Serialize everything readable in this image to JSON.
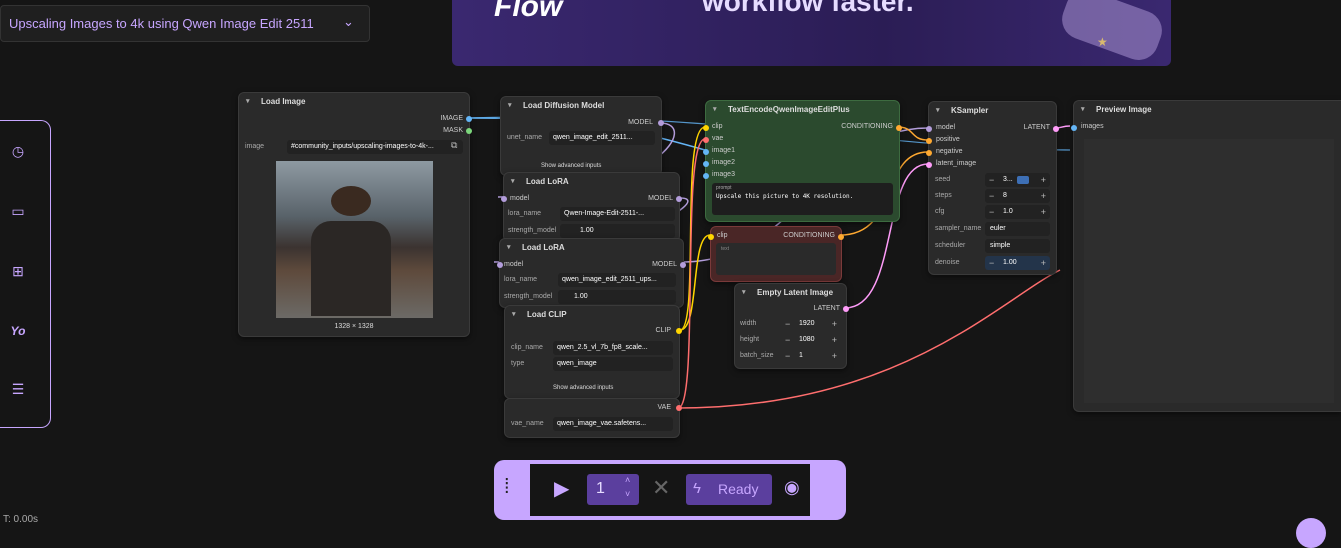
{
  "workflow": {
    "title": "Upscaling Images to 4k using Qwen Image Edit 2511"
  },
  "banner": {
    "logo_text": "Flow",
    "tagline": "workflow faster."
  },
  "sidebar": {
    "items": [
      {
        "icon": "clock-icon",
        "glyph": "◷"
      },
      {
        "icon": "folder-icon",
        "glyph": "▭"
      },
      {
        "icon": "workflow-icon",
        "glyph": "⊞"
      },
      {
        "icon": "logo-icon",
        "glyph": "Yo"
      },
      {
        "icon": "sliders-icon",
        "glyph": "☰"
      }
    ]
  },
  "nodes": {
    "load_image": {
      "title": "Load Image",
      "out1": "IMAGE",
      "out2": "MASK",
      "label": "image",
      "value": "#community_inputs/upscaling-images-to-4k-...",
      "dims": "1328 × 1328"
    },
    "load_diffusion": {
      "title": "Load Diffusion Model",
      "out": "MODEL",
      "label": "unet_name",
      "value": "qwen_image_edit_2511...",
      "advanced": "Show advanced inputs"
    },
    "lora1": {
      "title": "Load LoRA",
      "in": "model",
      "out": "MODEL",
      "l1": "lora_name",
      "v1": "Qwen-Image-Edit-2511-...",
      "l2": "strength_model",
      "v2": "1.00"
    },
    "lora2": {
      "title": "Load LoRA",
      "in": "model",
      "out": "MODEL",
      "l1": "lora_name",
      "v1": "qwen_image_edit_2511_ups...",
      "l2": "strength_model",
      "v2": "1.00"
    },
    "load_clip": {
      "title": "Load CLIP",
      "out": "CLIP",
      "l1": "clip_name",
      "v1": "qwen_2.5_vl_7b_fp8_scale...",
      "l2": "type",
      "v2": "qwen_image",
      "advanced": "Show advanced inputs"
    },
    "vae": {
      "out": "VAE",
      "label": "vae_name",
      "value": "qwen_image_vae.safetens..."
    },
    "text_encode": {
      "title": "TextEncodeQwenImageEditPlus",
      "inputs": [
        "clip",
        "vae",
        "image1",
        "image2",
        "image3"
      ],
      "out": "CONDITIONING",
      "prompt_label": "prompt",
      "prompt": "Upscale this picture to 4K resolution."
    },
    "clip_encode": {
      "in": "clip",
      "out": "CONDITIONING",
      "text_label": "text"
    },
    "empty_latent": {
      "title": "Empty Latent Image",
      "out": "LATENT",
      "fields": [
        {
          "label": "width",
          "value": "1920"
        },
        {
          "label": "height",
          "value": "1080"
        },
        {
          "label": "batch_size",
          "value": "1"
        }
      ]
    },
    "ksampler": {
      "title": "KSampler",
      "inputs": [
        "model",
        "positive",
        "negative",
        "latent_image"
      ],
      "out": "LATENT",
      "fields": [
        {
          "label": "seed",
          "value": "3..."
        },
        {
          "label": "steps",
          "value": "8"
        },
        {
          "label": "cfg",
          "value": "1.0"
        },
        {
          "label": "sampler_name",
          "value": "euler"
        },
        {
          "label": "scheduler",
          "value": "simple"
        },
        {
          "label": "denoise",
          "value": "1.00"
        }
      ]
    },
    "preview": {
      "title": "Preview Image",
      "in": "images"
    }
  },
  "runbar": {
    "count": "1",
    "status": "Ready"
  },
  "footer": {
    "timer": "T: 0.00s"
  },
  "colors": {
    "accent": "#c7a6ff",
    "model": "#b39ddb",
    "clip": "#ffd500",
    "vae": "#ff6e6e",
    "image": "#64b5f6",
    "latent": "#ff9cf9",
    "cond": "#ffa931",
    "green_node": "#2b4a2e",
    "red_node": "#4a2626"
  }
}
